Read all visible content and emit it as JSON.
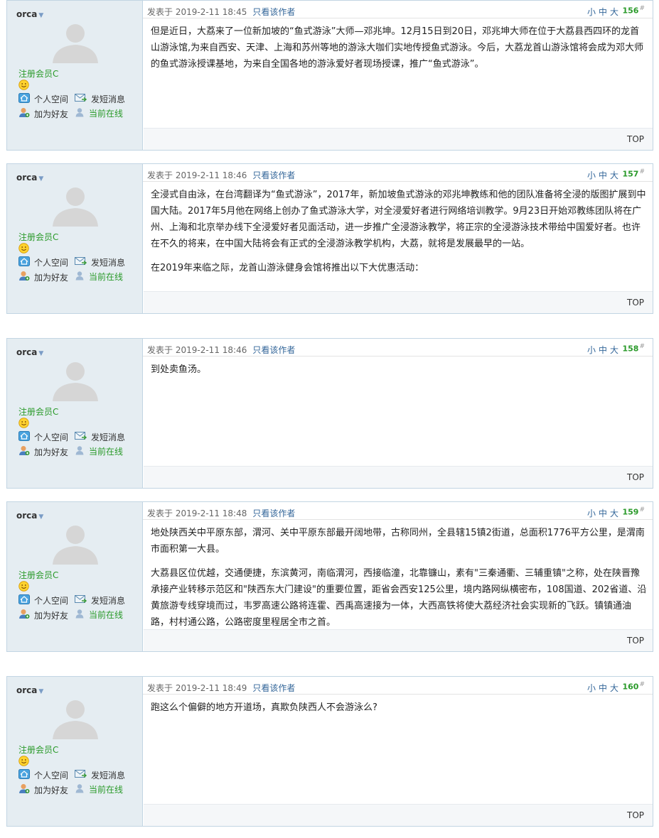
{
  "ui": {
    "posted_prefix": "发表于",
    "author_only_label": "只看该作者",
    "font_small": "小",
    "font_medium": "中",
    "font_large": "大",
    "floor_suffix": "#",
    "top_label": "TOP",
    "role_label": "注册会员C",
    "personal_space_label": "个人空间",
    "send_message_label": "发短消息",
    "add_friend_label": "加为好友",
    "online_label": "当前在线",
    "colors": {
      "online_green": "#2a9a2a",
      "link_blue": "#336699",
      "sidebar_bg": "#e5edf2",
      "border": "#c2d5e3"
    },
    "icons": [
      "caret-down-icon",
      "avatar-placeholder-icon",
      "smiley-icon",
      "home-icon",
      "message-icon",
      "add-friend-icon",
      "online-user-icon"
    ]
  },
  "posts": [
    {
      "username": "orca",
      "timestamp": "2019-2-11 18:45",
      "floor": "156",
      "paragraphs": [
        "但是近日，大荔来了一位新加坡的“鱼式游泳”大师—邓兆坤。12月15日到20日，邓兆坤大师在位于大荔县西四环的龙首山游泳馆,为来自西安、天津、上海和苏州等地的游泳大咖们实地传授鱼式游泳。今后，大荔龙首山游泳馆将会成为邓大师的鱼式游泳授课基地，为来自全国各地的游泳爱好者现场授课，推广“鱼式游泳”。"
      ]
    },
    {
      "username": "orca",
      "timestamp": "2019-2-11 18:46",
      "floor": "157",
      "paragraphs": [
        "全浸式自由泳，在台湾翻译为“鱼式游泳”，2017年，新加坡鱼式游泳的邓兆坤教练和他的团队准备将全浸的版图扩展到中国大陆。2017年5月他在网络上创办了鱼式游泳大学，对全浸爱好者进行网络培训教学。9月23日开始邓教练团队将在广州、上海和北京举办线下全浸爱好者见面活动，进一步推广全浸游泳教学，将正宗的全浸游泳技术带给中国爱好者。也许在不久的将来，在中国大陆将会有正式的全浸游泳教学机构，大荔，就将是发展最早的一站。",
        "在2019年来临之际，龙首山游泳健身会馆将推出以下大优惠活动："
      ]
    },
    {
      "username": "orca",
      "timestamp": "2019-2-11 18:46",
      "floor": "158",
      "paragraphs": [
        "到处卖鱼汤。"
      ]
    },
    {
      "username": "orca",
      "timestamp": "2019-2-11 18:48",
      "floor": "159",
      "paragraphs": [
        "地处陕西关中平原东部，渭河、关中平原东部最开阔地带，古称同州，全县辖15镇2街道，总面积1776平方公里，是渭南市面积第一大县。",
        "大荔县区位优越，交通便捷，东滨黄河，南临渭河，西接临潼，北靠镰山，素有\"三秦通衢、三辅重镇\"之称，处在陕晋豫承接产业转移示范区和\"陕西东大门建设\"的重要位置，距省会西安125公里，境内路网纵横密布，108国道、202省道、沿黄旅游专线穿境而过，韦罗高速公路将连霍、西禹高速接为一体，大西高铁将使大荔经济社会实现新的飞跃。镇镇通油路，村村通公路，公路密度里程居全市之首。"
      ]
    },
    {
      "username": "orca",
      "timestamp": "2019-2-11 18:49",
      "floor": "160",
      "paragraphs": [
        "跑这么个偏僻的地方开道场，真欺负陕西人不会游泳么?"
      ]
    }
  ]
}
